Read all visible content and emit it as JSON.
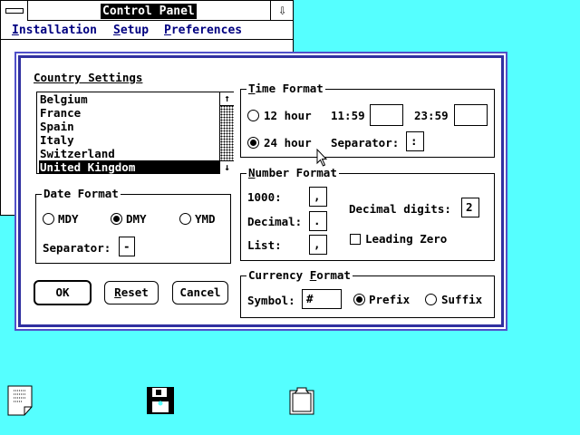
{
  "window": {
    "title": "Control Panel",
    "maximize_glyph": "⇩",
    "menu": [
      {
        "label": "Installation",
        "underline": "I",
        "rest": "nstallation"
      },
      {
        "label": "Setup",
        "underline": "S",
        "rest": "etup"
      },
      {
        "label": "Preferences",
        "underline": "P",
        "rest": "references"
      }
    ]
  },
  "dialog": {
    "title": "Country Settings",
    "countries": [
      "Belgium",
      "France",
      "Spain",
      "Italy",
      "Switzerland",
      "United Kingdom"
    ],
    "selected_country": "United Kingdom",
    "scroll_up": "↑",
    "scroll_down": "↓",
    "date_format": {
      "title": "Date Format",
      "options": [
        "MDY",
        "DMY",
        "YMD"
      ],
      "selected": "DMY",
      "separator_label": "Separator:",
      "separator_value": "-"
    },
    "time_format": {
      "title_underline": "T",
      "title_rest": "ime Format",
      "option_12": "12 hour",
      "option_24": "24 hour",
      "selected": "24 hour",
      "am_label": "11:59",
      "am_value": "",
      "pm_label": "23:59",
      "pm_value": "",
      "separator_label": "Separator:",
      "separator_value": ":"
    },
    "number_format": {
      "title_underline": "N",
      "title_rest": "umber Format",
      "thousand_label": "1000:",
      "thousand_value": ",",
      "decimal_label": "Decimal:",
      "decimal_value": ".",
      "list_label": "List:",
      "list_value": ",",
      "decimal_digits_label": "Decimal digits:",
      "decimal_digits_value": "2",
      "leading_zero_label": "Leading Zero",
      "leading_zero_checked": false
    },
    "currency_format": {
      "title_pre": "Currency ",
      "title_underline": "F",
      "title_rest": "ormat",
      "symbol_label": "Symbol:",
      "symbol_value": "#",
      "prefix_label": "Prefix",
      "suffix_label": "Suffix",
      "selected": "Prefix"
    },
    "buttons": {
      "ok": "OK",
      "reset_underline": "R",
      "reset_rest": "eset",
      "cancel": "Cancel"
    }
  },
  "desktop_icons": [
    "document-icon",
    "disk-icon",
    "clipboard-icon"
  ]
}
